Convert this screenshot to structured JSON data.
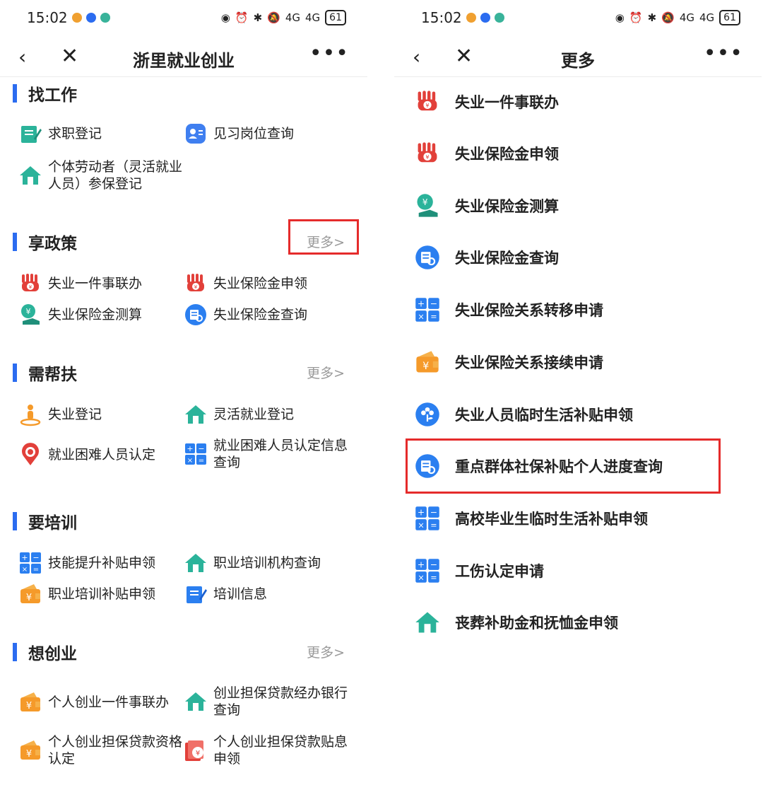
{
  "status": {
    "time": "15:02",
    "net1": "4G",
    "net2": "4G",
    "battery": "61"
  },
  "left": {
    "nav": {
      "title": "浙里就业创业",
      "more": "•••"
    },
    "sections": [
      {
        "title": "找工作",
        "more": "",
        "items": [
          "求职登记",
          "见习岗位查询",
          "个体劳动者（灵活就业人员）参保登记"
        ]
      },
      {
        "title": "享政策",
        "more": "更多>",
        "items": [
          "失业一件事联办",
          "失业保险金申领",
          "失业保险金测算",
          "失业保险金查询"
        ]
      },
      {
        "title": "需帮扶",
        "more": "更多>",
        "items": [
          "失业登记",
          "灵活就业登记",
          "就业困难人员认定",
          "就业困难人员认定信息查询"
        ]
      },
      {
        "title": "要培训",
        "more": "",
        "items": [
          "技能提升补贴申领",
          "职业培训机构查询",
          "职业培训补贴申领",
          "培训信息"
        ]
      },
      {
        "title": "想创业",
        "more": "更多>",
        "items": [
          "个人创业一件事联办",
          "创业担保贷款经办银行查询",
          "个人创业担保贷款资格认定",
          "个人创业担保贷款贴息申领"
        ]
      }
    ]
  },
  "right": {
    "nav": {
      "title": "更多",
      "more": "•••"
    },
    "items": [
      "失业一件事联办",
      "失业保险金申领",
      "失业保险金测算",
      "失业保险金查询",
      "失业保险关系转移申请",
      "失业保险关系接续申请",
      "失业人员临时生活补贴申领",
      "重点群体社保补贴个人进度查询",
      "高校毕业生临时生活补贴申领",
      "工伤认定申请",
      "丧葬补助金和抚恤金申领"
    ]
  },
  "colors": {
    "accent": "#2b6cf0",
    "highlight": "#e52b2b",
    "orange": "#f59a2a",
    "red": "#e2403a",
    "green": "#2bb39a"
  },
  "icons": [
    "register-icon",
    "profile-card-icon",
    "house-icon",
    "fist-icon",
    "hand-coin-icon",
    "search-doc-icon",
    "calculator-icon",
    "wallet-icon",
    "flower-icon",
    "person-pin-icon",
    "location-pin-icon",
    "pen-icon",
    "loan-icon"
  ]
}
